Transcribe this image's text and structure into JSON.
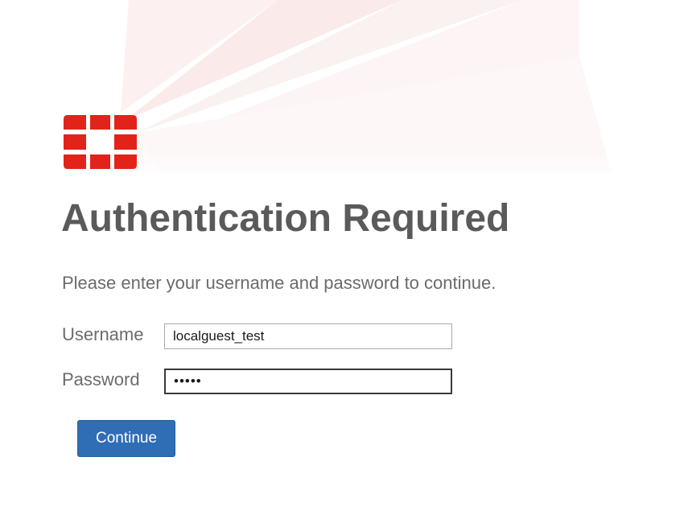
{
  "header": {
    "logo_icon": "fortinet-logo-icon",
    "brand_color": "#e2231a"
  },
  "main": {
    "title": "Authentication Required",
    "instructions": "Please enter your username and password to continue."
  },
  "form": {
    "username_label": "Username",
    "username_value": "localguest_test",
    "password_label": "Password",
    "password_value": "•••••",
    "continue_label": "Continue",
    "button_color": "#2f6db5"
  }
}
